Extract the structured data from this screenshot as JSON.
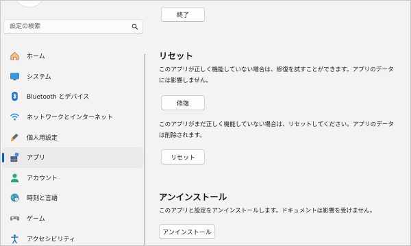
{
  "search": {
    "placeholder": "設定の検索"
  },
  "sidebar": {
    "items": [
      {
        "label": "ホーム",
        "icon": "home-icon"
      },
      {
        "label": "システム",
        "icon": "system-icon"
      },
      {
        "label": "Bluetooth とデバイス",
        "icon": "bluetooth-icon"
      },
      {
        "label": "ネットワークとインターネット",
        "icon": "wifi-icon"
      },
      {
        "label": "個人用設定",
        "icon": "personalization-icon"
      },
      {
        "label": "アプリ",
        "icon": "apps-icon",
        "selected": true
      },
      {
        "label": "アカウント",
        "icon": "account-icon"
      },
      {
        "label": "時刻と言語",
        "icon": "time-language-icon"
      },
      {
        "label": "ゲーム",
        "icon": "gaming-icon"
      },
      {
        "label": "アクセシビリティ",
        "icon": "accessibility-icon"
      }
    ]
  },
  "main": {
    "terminate_button": "終了",
    "reset_section": {
      "heading": "リセット",
      "repair_text": "このアプリが正しく機能していない場合は、修復を試すことができます。アプリのデータには影響しません。",
      "repair_button": "修復",
      "reset_text": "このアプリがまだ正しく機能していない場合は、リセットしてください。アプリのデータは削除されます。",
      "reset_button": "リセット"
    },
    "uninstall_section": {
      "heading": "アンインストール",
      "text": "このアプリと設定をアンインストールします。ドキュメントは影響を受けません。",
      "button": "アンインストール"
    }
  },
  "colors": {
    "accent": "#005fb8",
    "background": "#f3f3f3"
  }
}
